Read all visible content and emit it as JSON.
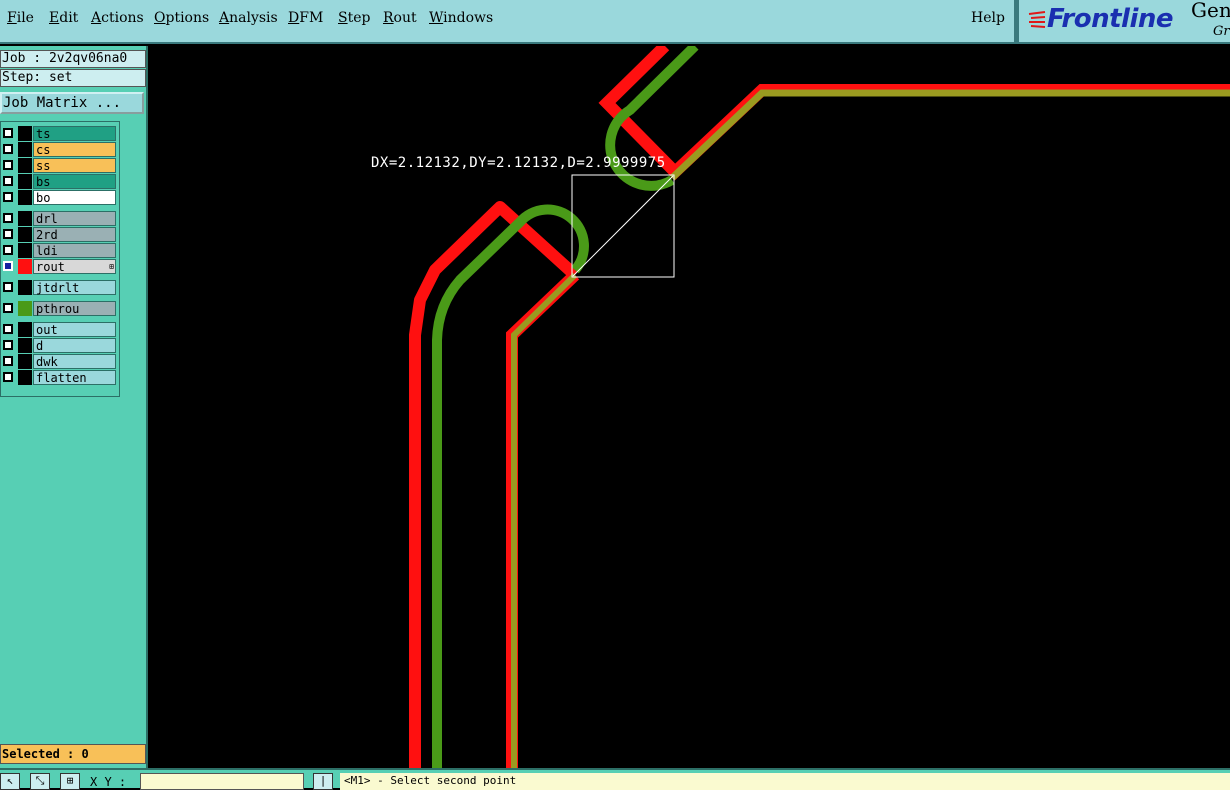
{
  "menubar": {
    "items": [
      {
        "mnemonic": "F",
        "rest": "ile"
      },
      {
        "mnemonic": "E",
        "rest": "dit"
      },
      {
        "mnemonic": "A",
        "rest": "ctions"
      },
      {
        "mnemonic": "O",
        "rest": "ptions"
      },
      {
        "mnemonic": "A",
        "rest": "nalysis"
      },
      {
        "mnemonic": "D",
        "rest": "FM"
      },
      {
        "mnemonic": "S",
        "rest": "tep"
      },
      {
        "mnemonic": "R",
        "rest": "out"
      },
      {
        "mnemonic": "W",
        "rest": "indows"
      }
    ],
    "help": "Help"
  },
  "logo": {
    "brand": "Frontline",
    "gen": "Gen",
    "gro": "Gro"
  },
  "leftpanel": {
    "job": "Job : 2v2qv06na0",
    "step": "Step: set",
    "job_matrix": "Job Matrix ...",
    "selected": "Selected : 0",
    "layers": [
      {
        "name": "ts",
        "bg": "#20a084",
        "active": false,
        "swatch": "#000000"
      },
      {
        "name": "cs",
        "bg": "#f8c058",
        "active": false,
        "swatch": "#000000"
      },
      {
        "name": "ss",
        "bg": "#f8c058",
        "active": false,
        "swatch": "#000000"
      },
      {
        "name": "bs",
        "bg": "#20a084",
        "active": false,
        "swatch": "#000000"
      },
      {
        "name": "bo",
        "bg": "#ffffff",
        "active": false,
        "swatch": "#000000"
      },
      {
        "name": "drl",
        "bg": "#9ab0b4",
        "active": false,
        "swatch": "#000000"
      },
      {
        "name": "2rd",
        "bg": "#9ab0b4",
        "active": false,
        "swatch": "#000000"
      },
      {
        "name": "ldi",
        "bg": "#9ab0b4",
        "active": false,
        "swatch": "#000000"
      },
      {
        "name": "rout",
        "bg": "#d8d8d8",
        "active": true,
        "swatch": "#ff1010"
      },
      {
        "name": "jtdrlt",
        "bg": "#9ad8dc",
        "active": false,
        "swatch": "#000000"
      },
      {
        "name": "pthrou",
        "bg": "#9ab0b4",
        "active": false,
        "swatch": "#4a9a18"
      },
      {
        "name": "out",
        "bg": "#9ad8dc",
        "active": false,
        "swatch": "#000000"
      },
      {
        "name": "d",
        "bg": "#9ad8dc",
        "active": false,
        "swatch": "#000000"
      },
      {
        "name": "dwk",
        "bg": "#9ad8dc",
        "active": false,
        "swatch": "#000000"
      },
      {
        "name": "flatten",
        "bg": "#9ad8dc",
        "active": false,
        "swatch": "#000000"
      }
    ]
  },
  "canvas": {
    "measure": "DX=2.12132,DY=2.12132,D=2.9999975",
    "colors": {
      "rout": "#ff1010",
      "pthrou": "#4a9a18",
      "overlap": "#b0a020"
    }
  },
  "bottombar": {
    "xy_label": "X Y :",
    "xy_value": "",
    "prompt": "<M1> - Select second point"
  }
}
